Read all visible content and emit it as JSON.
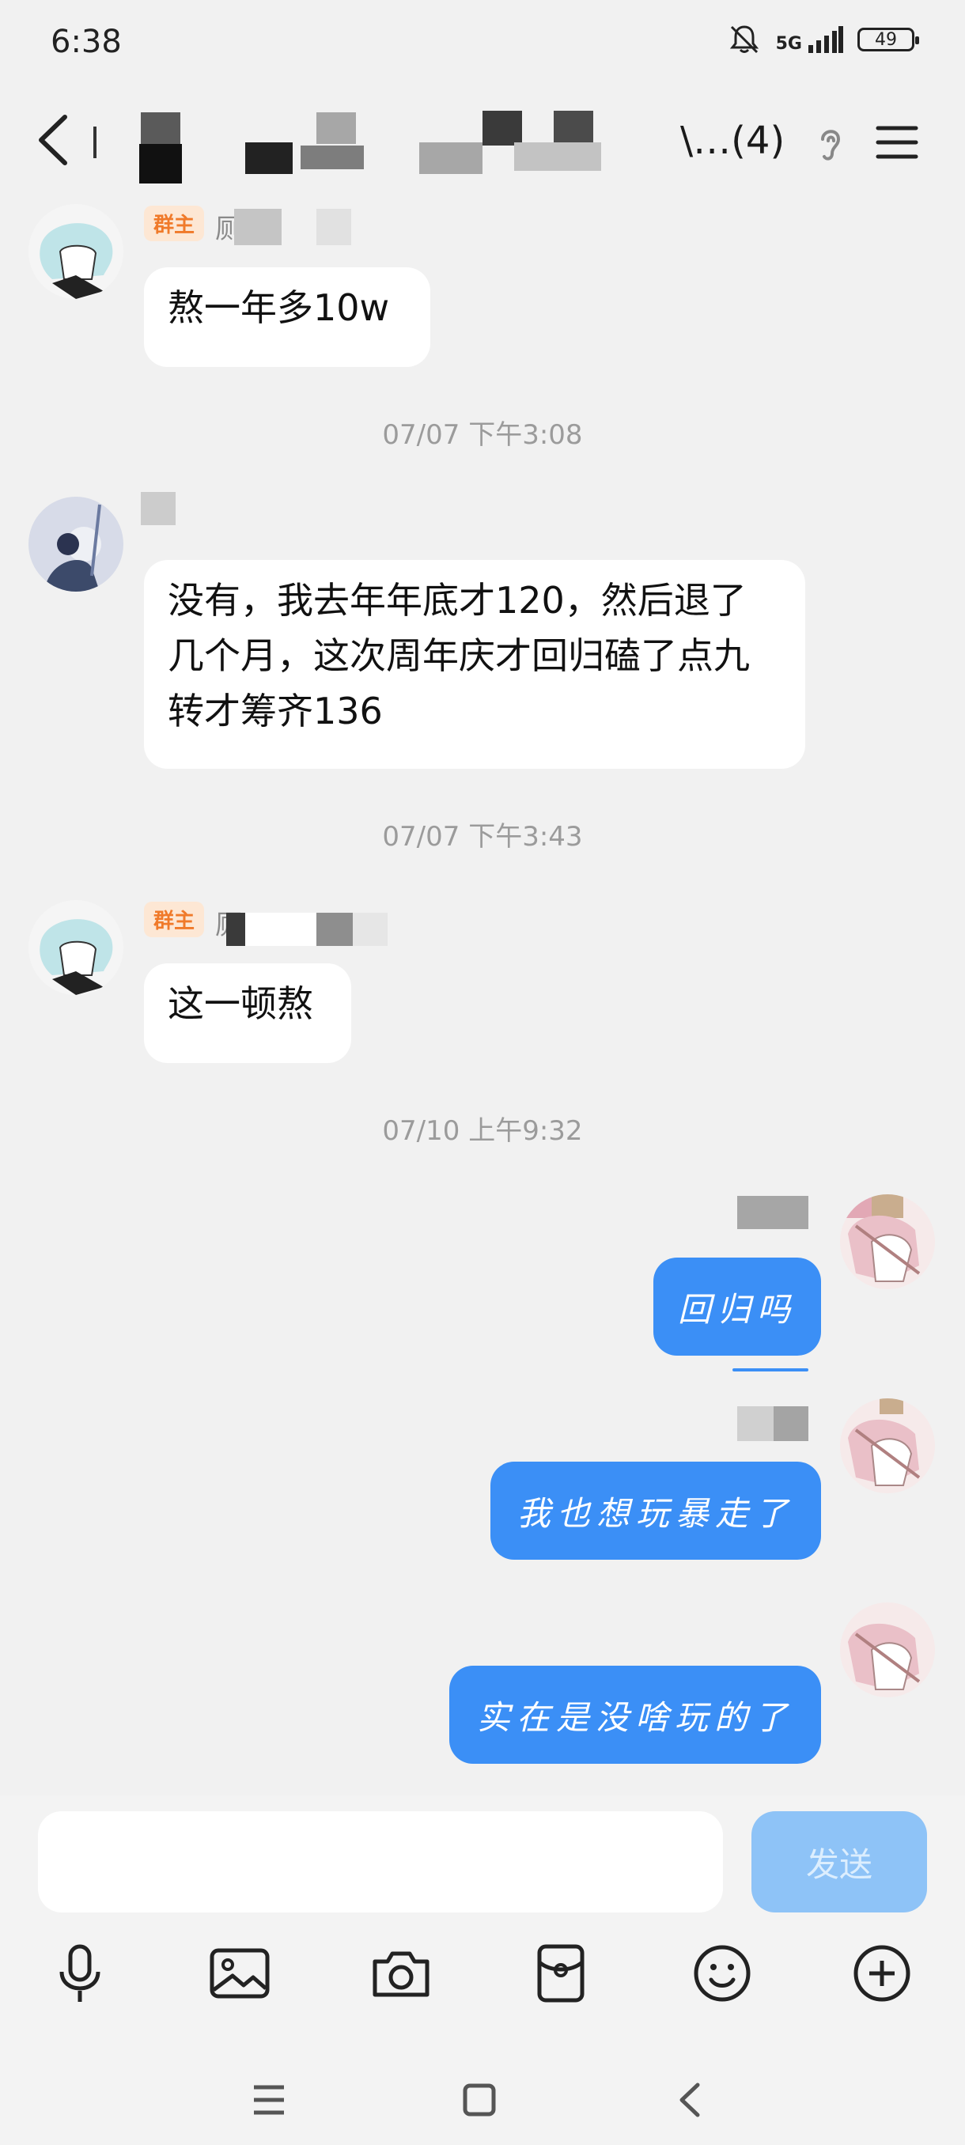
{
  "status_bar": {
    "time": "6:38",
    "network": "5G",
    "battery": "49"
  },
  "header": {
    "title_tail": "\\…(4)"
  },
  "colors": {
    "accent": "#3b8ff6",
    "send_disabled": "#8ec3f7",
    "owner_badge": "#f07a2a"
  },
  "messages": [
    {
      "badge": "群主",
      "name_fragment": "厕",
      "text": "熬一年多10w"
    },
    {
      "time": "07/07 下午3:08"
    },
    {
      "text": "没有，我去年年底才120，然后退了几个月，这次周年庆才回归磕了点九转才筹齐136"
    },
    {
      "time": "07/07 下午3:43"
    },
    {
      "badge": "群主",
      "name_fragment": "厕",
      "text": "这一顿熬"
    },
    {
      "time": "07/10 上午9:32"
    },
    {
      "text": "回归吗"
    },
    {
      "text": "我也想玩暴走了"
    },
    {
      "text": "实在是没啥玩的了"
    }
  ],
  "composer": {
    "input_value": "",
    "send_label": "发送"
  },
  "toolbar": [
    "microphone-icon",
    "image-icon",
    "camera-icon",
    "red-packet-icon",
    "emoji-icon",
    "plus-icon"
  ],
  "system_nav": [
    "recents-icon",
    "home-icon",
    "back-icon"
  ]
}
